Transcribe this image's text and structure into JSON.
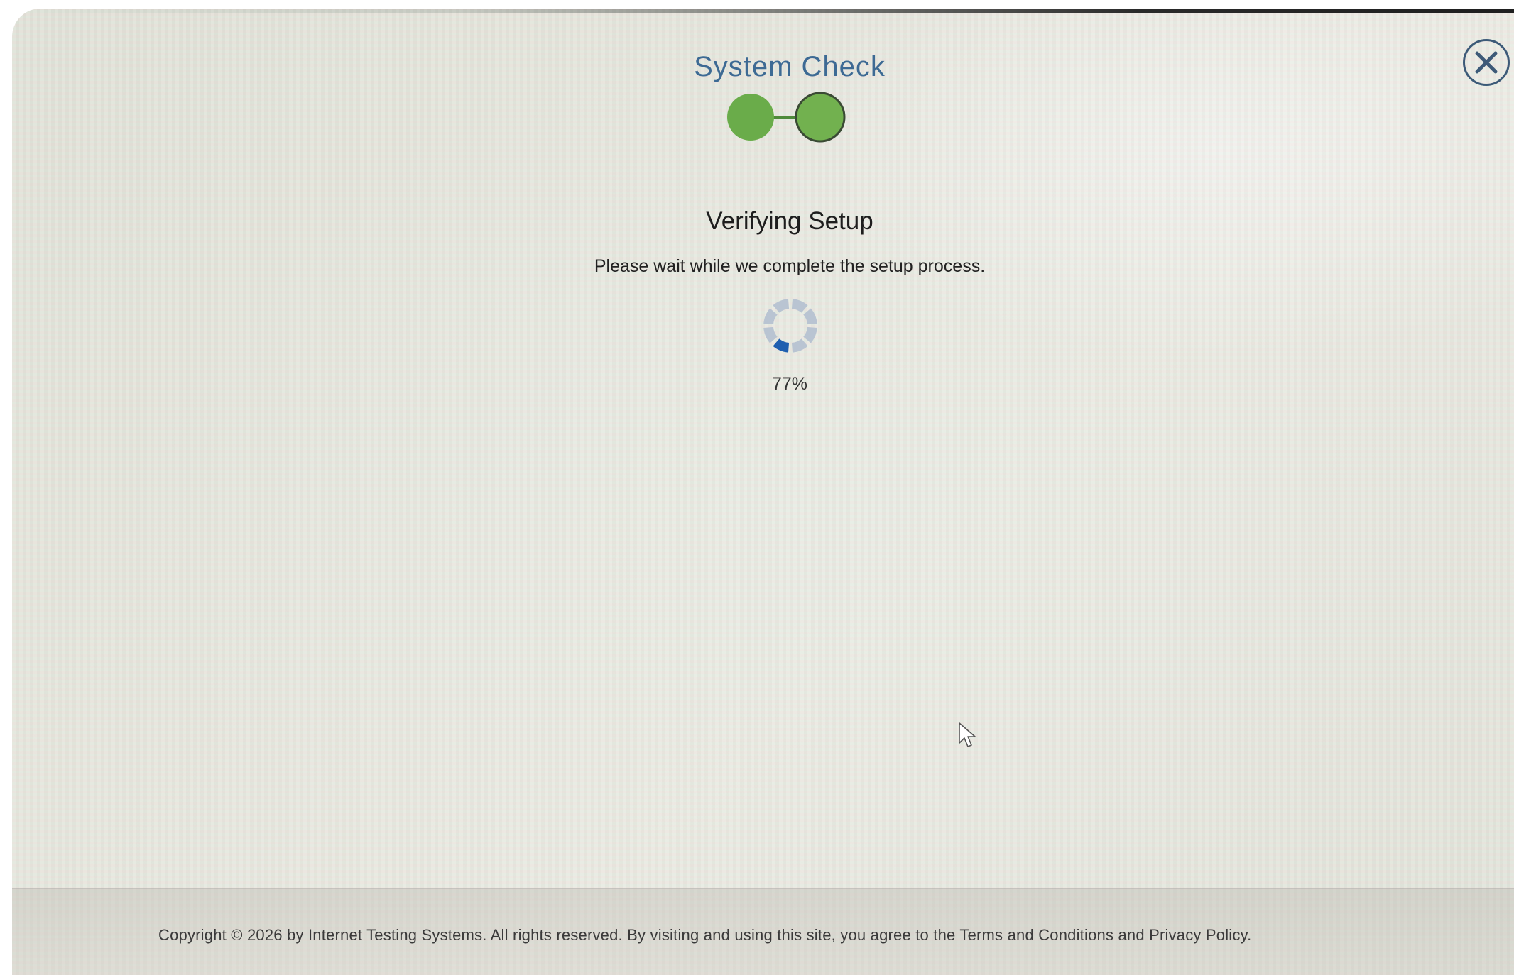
{
  "page": {
    "title": "System Check",
    "heading": "Verifying Setup",
    "message": "Please wait while we complete the setup process.",
    "progress_label": "77%",
    "progress_value": 0.77,
    "close_icon": "close-icon",
    "close_label": "Close"
  },
  "steps": {
    "total": 2,
    "completed": 1,
    "current": 2,
    "color": "#6aac4a"
  },
  "footer": {
    "text": "Copyright © 2026 by Internet Testing Systems. All rights reserved. By visiting and using this site, you agree to the Terms and Conditions and Privacy Policy."
  },
  "colors": {
    "title": "#3d6a94",
    "spinner_active": "#1f5fb0",
    "spinner_inactive": "#b9c4d2",
    "step_green": "#6aac4a"
  }
}
